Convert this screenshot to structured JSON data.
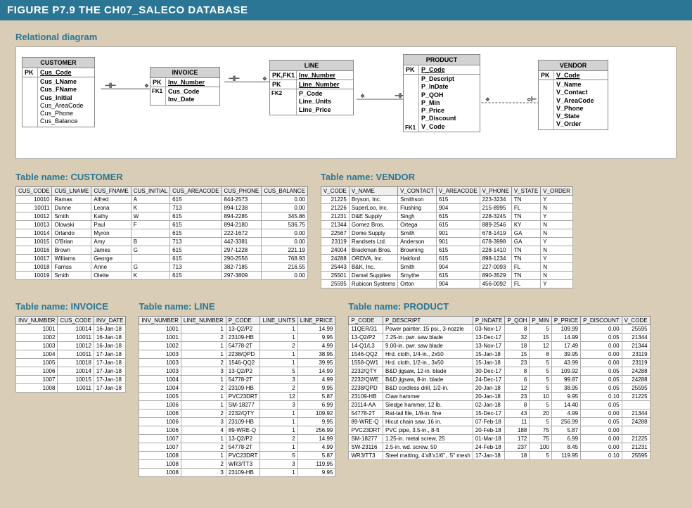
{
  "figure_title": "FIGURE P7.9  THE CH07_SALECO DATABASE",
  "sections": {
    "diagram_title": "Relational diagram",
    "customer_title": "Table name: CUSTOMER",
    "vendor_title": "Table name: VENDOR",
    "invoice_title": "Table name: INVOICE",
    "line_title": "Table name: LINE",
    "product_title": "Table name: PRODUCT"
  },
  "erd": {
    "customer": {
      "title": "CUSTOMER",
      "pk": "PK",
      "pk_col": "Cus_Code",
      "cols": [
        "Cus_LName",
        "Cus_FName",
        "Cus_Initial",
        "Cus_AreaCode",
        "Cus_Phone",
        "Cus_Balance"
      ]
    },
    "invoice": {
      "title": "INVOICE",
      "pk": "PK",
      "pk_col": "Inv_Number",
      "fk_label": "FK1",
      "cols": [
        "Cus_Code",
        "Inv_Date"
      ]
    },
    "line": {
      "title": "LINE",
      "pkrow1_label": "PK,FK1",
      "pkrow1_col": "Inv_Number",
      "pkrow2_label": "PK",
      "pkrow2_col": "Line_Number",
      "fk_label": "FK2",
      "cols": [
        "P_Code",
        "Line_Units",
        "Line_Price"
      ]
    },
    "product": {
      "title": "PRODUCT",
      "pk": "PK",
      "pk_col": "P_Code",
      "fk_label": "FK1",
      "cols": [
        "P_Descript",
        "P_InDate",
        "P_QOH",
        "P_Min",
        "P_Price",
        "P_Discount",
        "V_Code"
      ]
    },
    "vendor": {
      "title": "VENDOR",
      "pk": "PK",
      "pk_col": "V_Code",
      "cols": [
        "V_Name",
        "V_Contact",
        "V_AreaCode",
        "V_Phone",
        "V_State",
        "V_Order"
      ]
    }
  },
  "customer_headers": [
    "CUS_CODE",
    "CUS_LNAME",
    "CUS_FNAME",
    "CUS_INITIAL",
    "CUS_AREACODE",
    "CUS_PHONE",
    "CUS_BALANCE"
  ],
  "customer_rows": [
    [
      "10010",
      "Ramas",
      "Alfred",
      "A",
      "615",
      "844-2573",
      "0.00"
    ],
    [
      "10011",
      "Dunne",
      "Leona",
      "K",
      "713",
      "894-1238",
      "0.00"
    ],
    [
      "10012",
      "Smith",
      "Kathy",
      "W",
      "615",
      "894-2285",
      "345.86"
    ],
    [
      "10013",
      "Olowski",
      "Paul",
      "F",
      "615",
      "894-2180",
      "536.75"
    ],
    [
      "10014",
      "Orlando",
      "Myron",
      "",
      "615",
      "222-1672",
      "0.00"
    ],
    [
      "10015",
      "O'Brian",
      "Amy",
      "B",
      "713",
      "442-3381",
      "0.00"
    ],
    [
      "10016",
      "Brown",
      "James",
      "G",
      "615",
      "297-1228",
      "221.19"
    ],
    [
      "10017",
      "Williams",
      "George",
      "",
      "615",
      "290-2556",
      "768.93"
    ],
    [
      "10018",
      "Farriss",
      "Anne",
      "G",
      "713",
      "382-7185",
      "216.55"
    ],
    [
      "10019",
      "Smith",
      "Olette",
      "K",
      "615",
      "297-3809",
      "0.00"
    ]
  ],
  "vendor_headers": [
    "V_CODE",
    "V_NAME",
    "V_CONTACT",
    "V_AREACODE",
    "V_PHONE",
    "V_STATE",
    "V_ORDER"
  ],
  "vendor_rows": [
    [
      "21225",
      "Bryson, Inc.",
      "Smithson",
      "615",
      "223-3234",
      "TN",
      "Y"
    ],
    [
      "21226",
      "SuperLoo, Inc.",
      "Flushing",
      "904",
      "215-8995",
      "FL",
      "N"
    ],
    [
      "21231",
      "D&E Supply",
      "Singh",
      "615",
      "228-3245",
      "TN",
      "Y"
    ],
    [
      "21344",
      "Gomez Bros.",
      "Ortega",
      "615",
      "889-2546",
      "KY",
      "N"
    ],
    [
      "22567",
      "Dome Supply",
      "Smith",
      "901",
      "678-1419",
      "GA",
      "N"
    ],
    [
      "23119",
      "Randsets Ltd.",
      "Anderson",
      "901",
      "678-3998",
      "GA",
      "Y"
    ],
    [
      "24004",
      "Brackman Bros.",
      "Browning",
      "615",
      "228-1410",
      "TN",
      "N"
    ],
    [
      "24288",
      "ORDVA, Inc.",
      "Hakford",
      "615",
      "898-1234",
      "TN",
      "Y"
    ],
    [
      "25443",
      "B&K, Inc.",
      "Smith",
      "904",
      "227-0093",
      "FL",
      "N"
    ],
    [
      "25501",
      "Damal Supplies",
      "Smythe",
      "615",
      "890-3529",
      "TN",
      "N"
    ],
    [
      "25595",
      "Rubicon Systems",
      "Orton",
      "904",
      "456-0092",
      "FL",
      "Y"
    ]
  ],
  "invoice_headers": [
    "INV_NUMBER",
    "CUS_CODE",
    "INV_DATE"
  ],
  "invoice_rows": [
    [
      "1001",
      "10014",
      "16-Jan-18"
    ],
    [
      "1002",
      "10011",
      "16-Jan-18"
    ],
    [
      "1003",
      "10012",
      "16-Jan-18"
    ],
    [
      "1004",
      "10011",
      "17-Jan-18"
    ],
    [
      "1005",
      "10018",
      "17-Jan-18"
    ],
    [
      "1006",
      "10014",
      "17-Jan-18"
    ],
    [
      "1007",
      "10015",
      "17-Jan-18"
    ],
    [
      "1008",
      "10011",
      "17-Jan-18"
    ]
  ],
  "line_headers": [
    "INV_NUMBER",
    "LINE_NUMBER",
    "P_CODE",
    "LINE_UNITS",
    "LINE_PRICE"
  ],
  "line_rows": [
    [
      "1001",
      "1",
      "13-Q2/P2",
      "1",
      "14.99"
    ],
    [
      "1001",
      "2",
      "23109-HB",
      "1",
      "9.95"
    ],
    [
      "1002",
      "1",
      "54778-2T",
      "2",
      "4.99"
    ],
    [
      "1003",
      "1",
      "2238/QPD",
      "1",
      "38.95"
    ],
    [
      "1003",
      "2",
      "1546-QQ2",
      "1",
      "39.95"
    ],
    [
      "1003",
      "3",
      "13-Q2/P2",
      "5",
      "14.99"
    ],
    [
      "1004",
      "1",
      "54778-2T",
      "3",
      "4.99"
    ],
    [
      "1004",
      "2",
      "23109-HB",
      "2",
      "9.95"
    ],
    [
      "1005",
      "1",
      "PVC23DRT",
      "12",
      "5.87"
    ],
    [
      "1006",
      "1",
      "SM-18277",
      "3",
      "6.99"
    ],
    [
      "1006",
      "2",
      "2232/QTY",
      "1",
      "109.92"
    ],
    [
      "1006",
      "3",
      "23109-HB",
      "1",
      "9.95"
    ],
    [
      "1006",
      "4",
      "89-WRE-Q",
      "1",
      "256.99"
    ],
    [
      "1007",
      "1",
      "13-Q2/P2",
      "2",
      "14.99"
    ],
    [
      "1007",
      "2",
      "54778-2T",
      "1",
      "4.99"
    ],
    [
      "1008",
      "1",
      "PVC23DRT",
      "5",
      "5.87"
    ],
    [
      "1008",
      "2",
      "WR3/TT3",
      "3",
      "119.95"
    ],
    [
      "1008",
      "3",
      "23109-HB",
      "1",
      "9.95"
    ]
  ],
  "product_headers": [
    "P_CODE",
    "P_DESCRIPT",
    "P_INDATE",
    "P_QOH",
    "P_MIN",
    "P_PRICE",
    "P_DISCOUNT",
    "V_CODE"
  ],
  "product_rows": [
    [
      "11QER/31",
      "Power painter, 15 psi., 3-nozzle",
      "03-Nov-17",
      "8",
      "5",
      "109.99",
      "0.00",
      "25595"
    ],
    [
      "13-Q2/P2",
      "7.25-in. pwr. saw blade",
      "13-Dec-17",
      "32",
      "15",
      "14.99",
      "0.05",
      "21344"
    ],
    [
      "14-Q1/L3",
      "9.00-in. pwr. saw blade",
      "13-Nov-17",
      "18",
      "12",
      "17.49",
      "0.00",
      "21344"
    ],
    [
      "1546-QQ2",
      "Hrd. cloth, 1/4-in., 2x50",
      "15-Jan-18",
      "15",
      "8",
      "39.95",
      "0.00",
      "23119"
    ],
    [
      "1558-QW1",
      "Hrd. cloth, 1/2-in., 3x50",
      "15-Jan-18",
      "23",
      "5",
      "43.99",
      "0.00",
      "23119"
    ],
    [
      "2232/QTY",
      "B&D jigsaw, 12-in. blade",
      "30-Dec-17",
      "8",
      "5",
      "109.92",
      "0.05",
      "24288"
    ],
    [
      "2232/QWE",
      "B&D jigsaw, 8-in. blade",
      "24-Dec-17",
      "6",
      "5",
      "99.87",
      "0.05",
      "24288"
    ],
    [
      "2238/QPD",
      "B&D cordless drill, 1/2-in.",
      "20-Jan-18",
      "12",
      "5",
      "38.95",
      "0.05",
      "25595"
    ],
    [
      "23109-HB",
      "Claw hammer",
      "20-Jan-18",
      "23",
      "10",
      "9.95",
      "0.10",
      "21225"
    ],
    [
      "23114-AA",
      "Sledge hammer, 12 lb.",
      "02-Jan-18",
      "8",
      "5",
      "14.40",
      "0.05",
      ""
    ],
    [
      "54778-2T",
      "Rat-tail file, 1/8-in. fine",
      "15-Dec-17",
      "43",
      "20",
      "4.99",
      "0.00",
      "21344"
    ],
    [
      "89-WRE-Q",
      "Hicut chain saw, 16 in.",
      "07-Feb-18",
      "11",
      "5",
      "256.99",
      "0.05",
      "24288"
    ],
    [
      "PVC23DRT",
      "PVC pipe, 3.5-in., 8-ft",
      "20-Feb-18",
      "188",
      "75",
      "5.87",
      "0.00",
      ""
    ],
    [
      "SM-18277",
      "1.25-in. metal screw, 25",
      "01-Mar-18",
      "172",
      "75",
      "6.99",
      "0.00",
      "21225"
    ],
    [
      "SW-23116",
      "2.5-in. wd. screw, 50",
      "24-Feb-18",
      "237",
      "100",
      "8.45",
      "0.00",
      "21231"
    ],
    [
      "WR3/TT3",
      "Steel matting, 4'x8'x1/6\", .5\" mesh",
      "17-Jan-18",
      "18",
      "5",
      "119.95",
      "0.10",
      "25595"
    ]
  ]
}
